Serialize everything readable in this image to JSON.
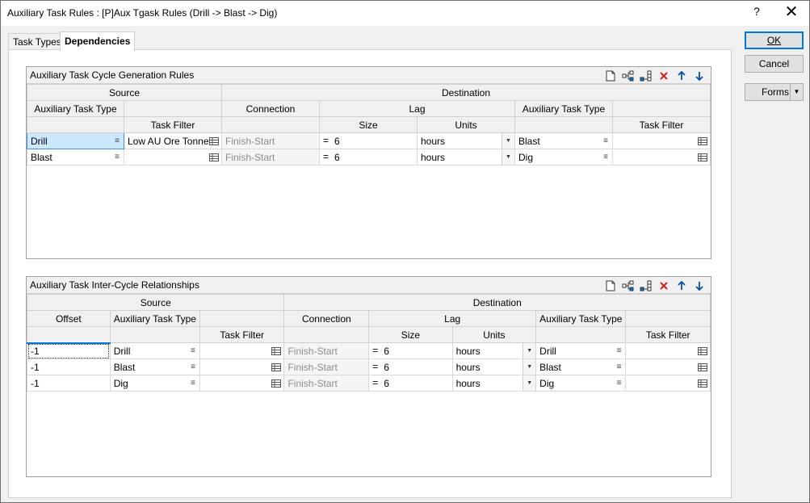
{
  "window": {
    "title": "Auxiliary Task Rules : [P]Aux Tgask Rules (Drill -> Blast -> Dig)",
    "help_label": "?",
    "close_label": "✕"
  },
  "tabs": [
    {
      "label": "Task Types"
    },
    {
      "label": "Dependencies"
    }
  ],
  "buttons": {
    "ok": "OK",
    "cancel": "Cancel",
    "forms": "Forms"
  },
  "cycle_rules": {
    "title": "Auxiliary Task Cycle Generation Rules",
    "headers": {
      "source": "Source",
      "destination": "Destination",
      "aux_task_type": "Auxiliary Task Type",
      "connection": "Connection",
      "lag": "Lag",
      "dest_aux_task_type": "Auxiliary Task Type",
      "task_filter": "Task Filter",
      "size": "Size",
      "units": "Units",
      "dest_task_filter": "Task Filter"
    },
    "rows": [
      {
        "source_type": "Drill",
        "source_filter": "Low AU Ore Tonne",
        "connection": "Finish-Start",
        "eq": "=",
        "size": "6",
        "units": "hours",
        "dest_type": "Blast",
        "dest_filter": ""
      },
      {
        "source_type": "Blast",
        "source_filter": "",
        "connection": "Finish-Start",
        "eq": "=",
        "size": "6",
        "units": "hours",
        "dest_type": "Dig",
        "dest_filter": ""
      }
    ]
  },
  "inter_cycle": {
    "title": "Auxiliary Task Inter-Cycle Relationships",
    "headers": {
      "source": "Source",
      "destination": "Destination",
      "offset": "Offset",
      "aux_task_type": "Auxiliary Task Type",
      "connection": "Connection",
      "lag": "Lag",
      "dest_aux_task_type": "Auxiliary Task Type",
      "task_filter": "Task Filter",
      "size": "Size",
      "units": "Units",
      "dest_task_filter": "Task Filter"
    },
    "rows": [
      {
        "offset": "-1",
        "source_type": "Drill",
        "source_filter": "",
        "connection": "Finish-Start",
        "eq": "=",
        "size": "6",
        "units": "hours",
        "dest_type": "Drill",
        "dest_filter": ""
      },
      {
        "offset": "-1",
        "source_type": "Blast",
        "source_filter": "",
        "connection": "Finish-Start",
        "eq": "=",
        "size": "6",
        "units": "hours",
        "dest_type": "Blast",
        "dest_filter": ""
      },
      {
        "offset": "-1",
        "source_type": "Dig",
        "source_filter": "",
        "connection": "Finish-Start",
        "eq": "=",
        "size": "6",
        "units": "hours",
        "dest_type": "Dig",
        "dest_filter": ""
      }
    ]
  },
  "toolbar_icons": [
    "new-row-icon",
    "insert-row-icon",
    "append-row-icon",
    "delete-row-icon",
    "move-up-icon",
    "move-down-icon"
  ],
  "colors": {
    "accent": "#0078d7",
    "delete": "#d02020",
    "selection": "#cce8ff"
  }
}
